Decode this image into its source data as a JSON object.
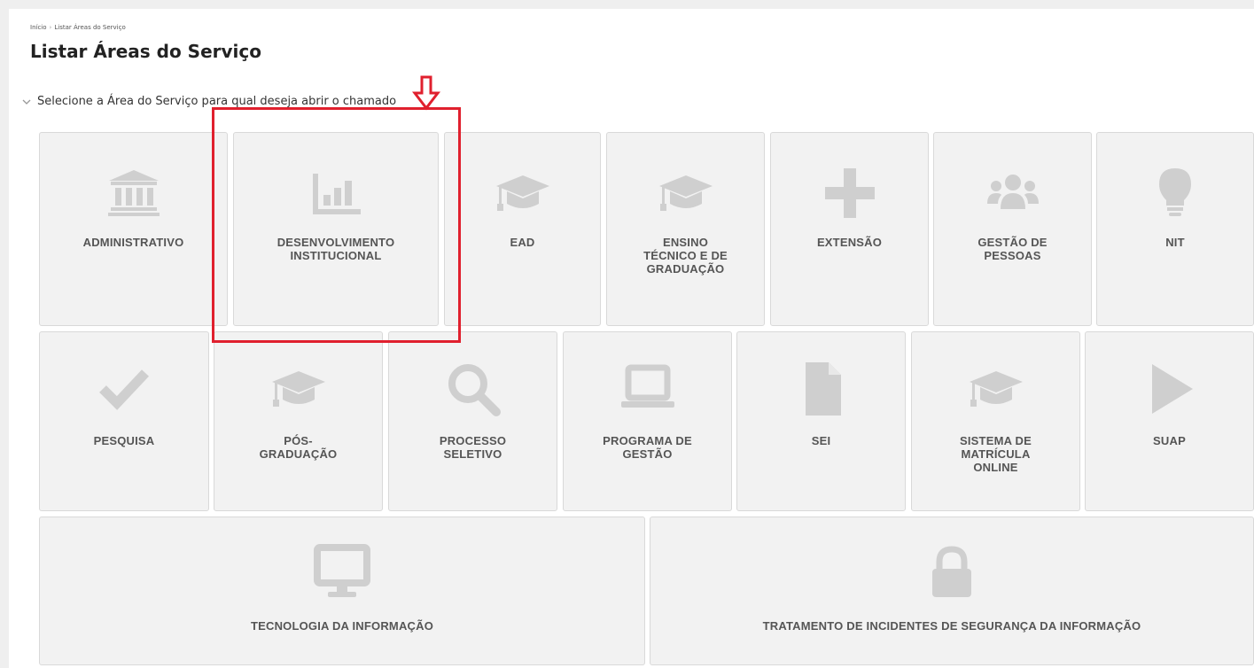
{
  "breadcrumb": {
    "home": "Início",
    "current": "Listar Áreas do Serviço"
  },
  "page_title": "Listar Áreas do Serviço",
  "instruction": "Selecione a Área do Serviço para qual deseja abrir o chamado",
  "colors": {
    "tile_bg": "#f2f2f2",
    "icon": "#cfcfcf",
    "label": "#555555",
    "highlight": "#e0202e"
  },
  "areas": [
    {
      "label": "ADMINISTRATIVO",
      "icon": "bank-icon"
    },
    {
      "label": "DESENVOLVIMENTO INSTITUCIONAL",
      "icon": "bar-chart-icon"
    },
    {
      "label": "EAD",
      "icon": "graduation-cap-icon"
    },
    {
      "label": "ENSINO TÉCNICO E DE GRADUAÇÃO",
      "icon": "graduation-cap-icon"
    },
    {
      "label": "EXTENSÃO",
      "icon": "plus-icon"
    },
    {
      "label": "GESTÃO DE PESSOAS",
      "icon": "users-icon"
    },
    {
      "label": "NIT",
      "icon": "lightbulb-icon"
    },
    {
      "label": "PESQUISA",
      "icon": "checkmark-icon"
    },
    {
      "label": "PÓS-GRADUAÇÃO",
      "icon": "graduation-cap-icon"
    },
    {
      "label": "PROCESSO SELETIVO",
      "icon": "search-icon"
    },
    {
      "label": "PROGRAMA DE GESTÃO",
      "icon": "laptop-icon"
    },
    {
      "label": "SEI",
      "icon": "file-icon"
    },
    {
      "label": "SISTEMA DE MATRÍCULA ONLINE",
      "icon": "graduation-cap-icon"
    },
    {
      "label": "SUAP",
      "icon": "play-icon"
    },
    {
      "label": "TECNOLOGIA DA INFORMAÇÃO",
      "icon": "desktop-icon"
    },
    {
      "label": "TRATAMENTO DE INCIDENTES DE SEGURANÇA DA INFORMAÇÃO",
      "icon": "lock-icon"
    }
  ]
}
